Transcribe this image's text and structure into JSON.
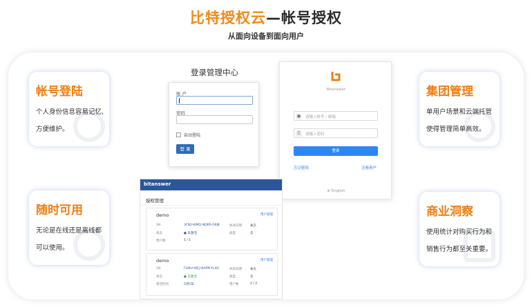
{
  "header": {
    "title_brand": "比特授权云",
    "title_rest": "—帐号授权",
    "subtitle": "从面向设备到面向用户"
  },
  "features": [
    {
      "title": "帐号登陆",
      "desc": "个人身份信息容易记忆,方便维护。",
      "icon": "user-badge-icon"
    },
    {
      "title": "随时可用",
      "desc": "无论是在线还是离线都可以使用。",
      "icon": "share-network-icon"
    },
    {
      "title": "集团管理",
      "desc": "单用户场景和云端托管使得管理简单高效。",
      "icon": "org-tree-icon"
    },
    {
      "title": "商业洞察",
      "desc": "使用统计对购买行为和销售行为都至关重要。",
      "icon": "document-icon"
    }
  ],
  "login_manage": {
    "heading": "登录管理中心",
    "account_label": "账 户",
    "password_label": "密码",
    "remember_label": "自动登陆",
    "submit_label": "登 录"
  },
  "user_login": {
    "brand": "Bitanswer",
    "account_placeholder": "请输入帐号 / 邮箱",
    "password_placeholder": "请输入密码",
    "login_button": "登录",
    "forgot_link": "忘记密码",
    "register_link": "注册用户",
    "language": "English"
  },
  "license_panel": {
    "logo": "bitanswer",
    "heading": "授权管理",
    "items": [
      {
        "name": "demo",
        "manage_link": "用户管理",
        "sn_label": "SN",
        "sn_value": "3FN2-WMQ-NQ6R-G6J8",
        "expire_label": "失效日期",
        "expire_value": "永久",
        "status_label": "状态",
        "status_value": "● 未激活",
        "type_label": "类型",
        "type_value": "云",
        "count_label": "用户数",
        "count_value": "1 / 1"
      },
      {
        "name": "demo",
        "manage_link": "用户管理",
        "sn_label": "SN",
        "sn_value": "FGNU-YKCJ-NAPM-YLXO",
        "expire_label": "失效日期",
        "expire_value": "永久",
        "status_label": "状态",
        "status_value": "● 已激活",
        "type_label": "类型",
        "type_value": "云",
        "count_label": "激活时间",
        "count_value": "5月5日",
        "extra_label": "用户数",
        "extra_value": "1 / 2"
      }
    ]
  },
  "colors": {
    "accent": "#ef7f14",
    "brand_blue": "#2c5698",
    "button_blue": "#2d86f5"
  }
}
